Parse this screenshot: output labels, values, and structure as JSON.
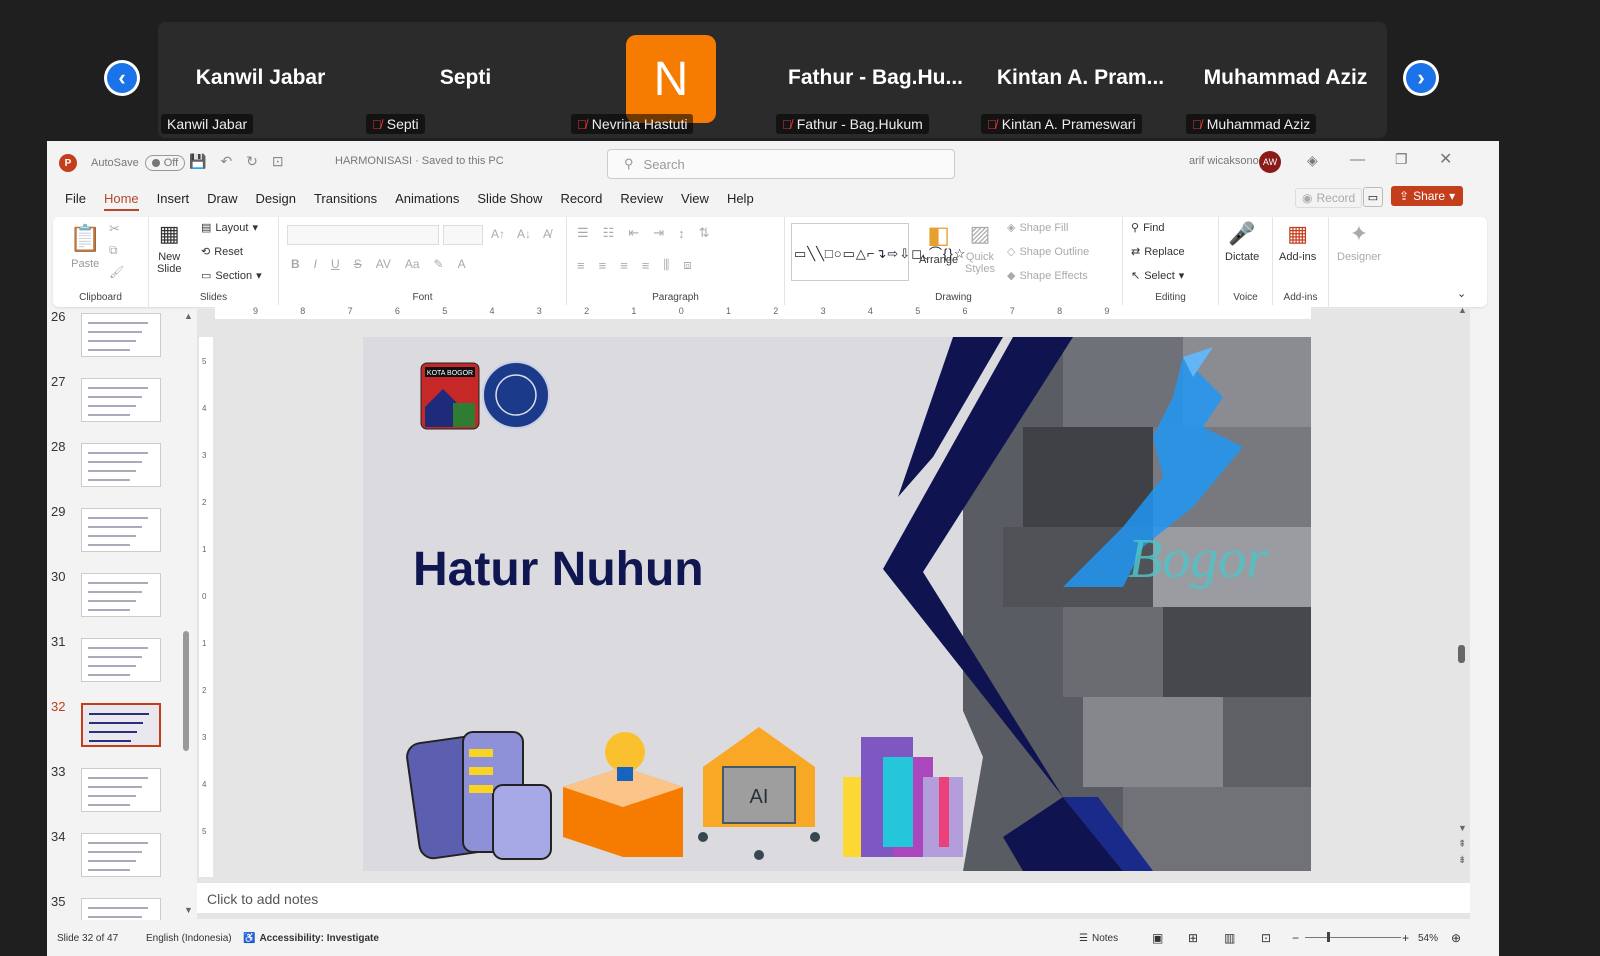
{
  "meeting": {
    "participants": [
      {
        "display": "Kanwil Jabar",
        "label": "Kanwil Jabar",
        "muted": false
      },
      {
        "display": "Septi",
        "label": "Septi",
        "muted": true
      },
      {
        "display": "N",
        "label": "Nevrina Hastuti",
        "muted": true
      },
      {
        "display": "Fathur - Bag.Hu...",
        "label": "Fathur - Bag.Hukum",
        "muted": true
      },
      {
        "display": "Kintan A. Pram...",
        "label": "Kintan A. Prameswari",
        "muted": true
      },
      {
        "display": "Muhammad Aziz",
        "label": "Muhammad Aziz",
        "muted": true
      }
    ],
    "prev_icon": "chevron-left-icon",
    "next_icon": "chevron-right-icon"
  },
  "window": {
    "autosave_label": "AutoSave",
    "autosave_state": "Off",
    "doc_title": "HARMONISASI · Saved to this PC",
    "search_placeholder": "Search",
    "user_name": "arif wicaksono",
    "user_initials": "AW"
  },
  "menu": {
    "tabs": [
      "File",
      "Home",
      "Insert",
      "Draw",
      "Design",
      "Transitions",
      "Animations",
      "Slide Show",
      "Record",
      "Review",
      "View",
      "Help"
    ],
    "active": "Home",
    "record_label": "Record",
    "share_label": "Share"
  },
  "ribbon": {
    "clipboard": {
      "label": "Clipboard",
      "paste": "Paste"
    },
    "slides": {
      "label": "Slides",
      "new_slide": "New\nSlide",
      "layout": "Layout",
      "reset": "Reset",
      "section": "Section"
    },
    "font": {
      "label": "Font"
    },
    "paragraph": {
      "label": "Paragraph"
    },
    "drawing": {
      "label": "Drawing",
      "arrange": "Arrange",
      "quick_styles": "Quick\nStyles",
      "shape_fill": "Shape Fill",
      "shape_outline": "Shape Outline",
      "shape_effects": "Shape Effects"
    },
    "editing": {
      "label": "Editing",
      "find": "Find",
      "replace": "Replace",
      "select": "Select"
    },
    "voice": {
      "label": "Voice",
      "dictate": "Dictate"
    },
    "addins": {
      "label": "Add-ins",
      "addins_btn": "Add-ins"
    },
    "designer": {
      "label": "Designer"
    }
  },
  "ruler": {
    "h_ticks": [
      "9",
      "8",
      "7",
      "6",
      "5",
      "4",
      "3",
      "2",
      "1",
      "0",
      "1",
      "2",
      "3",
      "4",
      "5",
      "6",
      "7",
      "8",
      "9"
    ],
    "v_ticks": [
      "5",
      "4",
      "3",
      "2",
      "1",
      "0",
      "1",
      "2",
      "3",
      "4",
      "5"
    ]
  },
  "thumbnails": [
    {
      "num": "26",
      "selected": false
    },
    {
      "num": "27",
      "selected": false
    },
    {
      "num": "28",
      "selected": false
    },
    {
      "num": "29",
      "selected": false
    },
    {
      "num": "30",
      "selected": false
    },
    {
      "num": "31",
      "selected": false
    },
    {
      "num": "32",
      "selected": true
    },
    {
      "num": "33",
      "selected": false
    },
    {
      "num": "34",
      "selected": false
    },
    {
      "num": "35",
      "selected": false
    }
  ],
  "slide": {
    "title": "Hatur Nuhun",
    "logo_left_text": "KOTA BOGOR",
    "photo_text": "Bogor",
    "icon_ai": "AI",
    "colors": {
      "navy": "#0f1450",
      "accent_blue": "#2196f3",
      "bg": "#dbdadf"
    }
  },
  "notes_placeholder": "Click to add notes",
  "status": {
    "slide_pos": "Slide 32 of 47",
    "language": "English (Indonesia)",
    "accessibility": "Accessibility: Investigate",
    "notes": "Notes",
    "zoom": "54%"
  }
}
